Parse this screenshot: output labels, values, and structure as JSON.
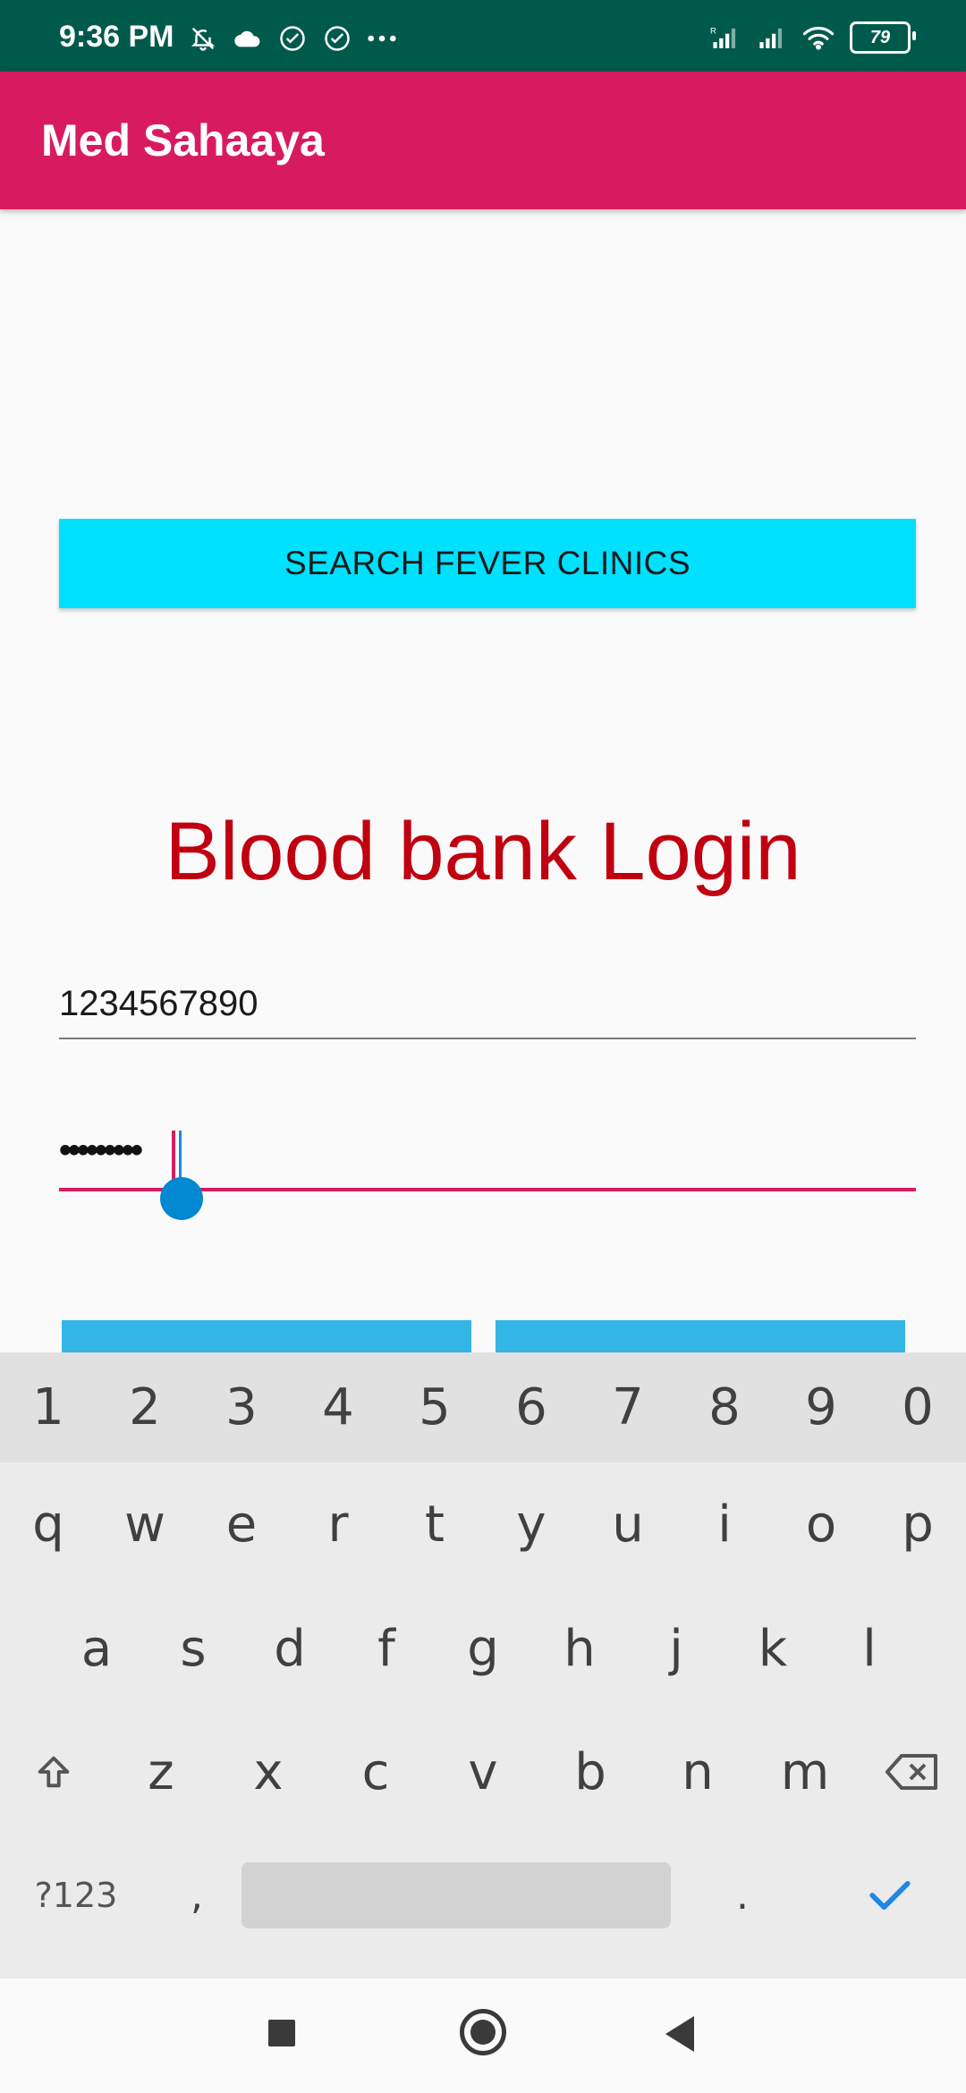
{
  "status_bar": {
    "time": "9:36 PM",
    "left_icons": [
      "bell-off-icon",
      "cloud-icon",
      "check-circle-icon",
      "check-circle-icon",
      "more-dots-icon"
    ],
    "right_icons": [
      "signal-roaming-icon",
      "signal-icon",
      "wifi-icon"
    ],
    "battery": "79",
    "background": "#005a4c"
  },
  "app_bar": {
    "title": "Med Sahaaya",
    "background": "#d81b60"
  },
  "main": {
    "search_button_label": "SEARCH FEVER CLINICS",
    "search_button_color": "#00e0ff",
    "login_title": "Blood bank Login",
    "login_title_color": "#c00010",
    "phone_value": "1234567890",
    "password_value": "•••••••••",
    "accent_color": "#d81b60"
  },
  "keyboard": {
    "numbers": [
      "1",
      "2",
      "3",
      "4",
      "5",
      "6",
      "7",
      "8",
      "9",
      "0"
    ],
    "row1": [
      "q",
      "w",
      "e",
      "r",
      "t",
      "y",
      "u",
      "i",
      "o",
      "p"
    ],
    "row2": [
      "a",
      "s",
      "d",
      "f",
      "g",
      "h",
      "j",
      "k",
      "l"
    ],
    "row3": [
      "z",
      "x",
      "c",
      "v",
      "b",
      "n",
      "m"
    ],
    "symbols_label": "?123",
    "comma": ",",
    "period": ".",
    "shift_icon": "shift-icon",
    "backspace_icon": "backspace-icon",
    "done_icon": "check-icon"
  },
  "nav_bar": {
    "icons": [
      "recents-icon",
      "home-icon",
      "back-icon"
    ]
  }
}
